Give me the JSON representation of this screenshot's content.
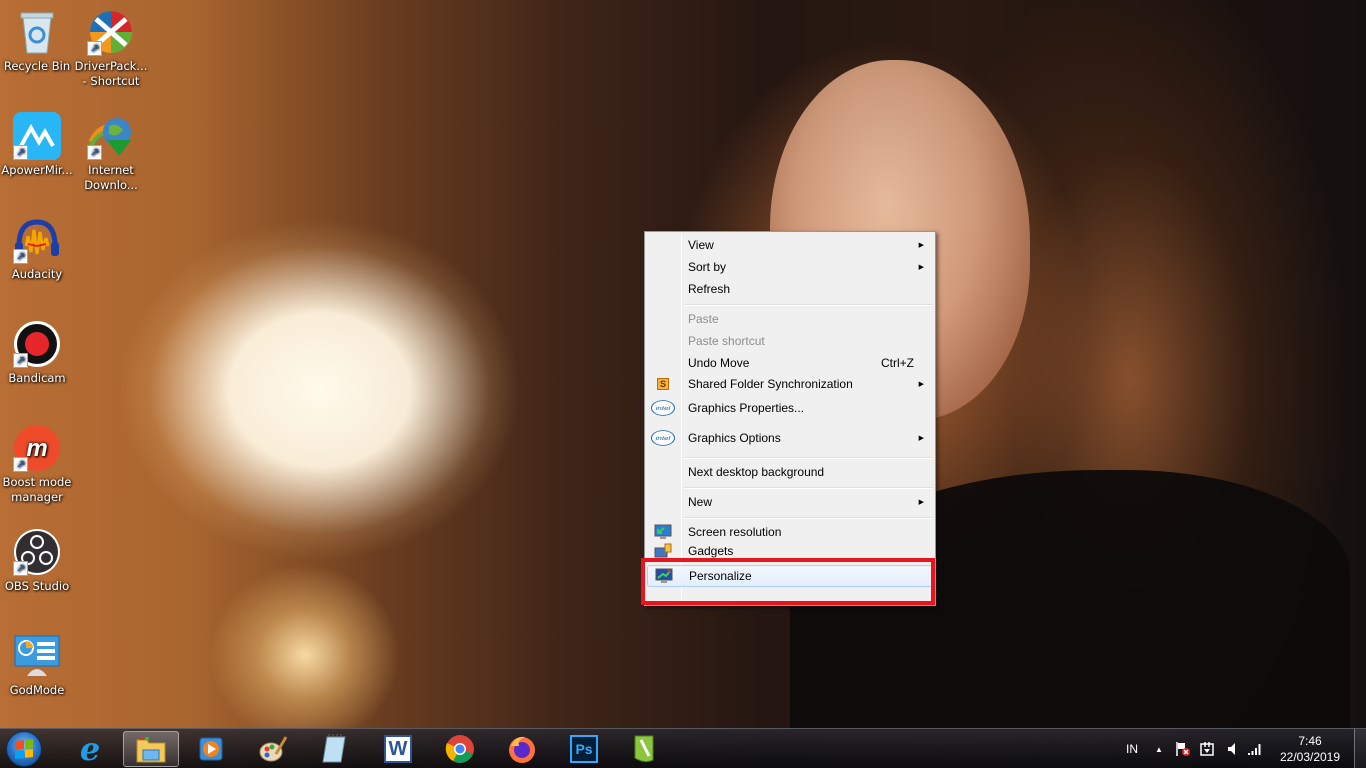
{
  "desktop": {
    "icons": [
      {
        "label": "Recycle Bin",
        "icon": "recycle-bin-icon",
        "shortcut": false
      },
      {
        "label": "DriverPack... - Shortcut",
        "icon": "driverpack-icon",
        "shortcut": true
      },
      {
        "label": "ApowerMir...",
        "icon": "apowermirror-icon",
        "shortcut": true
      },
      {
        "label": "Internet Downlo...",
        "icon": "internet-download-manager-icon",
        "shortcut": true
      },
      {
        "label": "Audacity",
        "icon": "audacity-icon",
        "shortcut": true
      },
      {
        "label": "Bandicam",
        "icon": "bandicam-icon",
        "shortcut": true
      },
      {
        "label": "Boost mode manager",
        "icon": "boost-mode-manager-icon",
        "shortcut": true
      },
      {
        "label": "OBS Studio",
        "icon": "obs-studio-icon",
        "shortcut": true
      },
      {
        "label": "GodMode",
        "icon": "godmode-icon",
        "shortcut": false
      }
    ]
  },
  "context_menu": {
    "items": [
      {
        "label": "View",
        "submenu": true
      },
      {
        "label": "Sort by",
        "submenu": true
      },
      {
        "label": "Refresh"
      },
      {
        "label": "Paste",
        "disabled": true
      },
      {
        "label": "Paste shortcut",
        "disabled": true
      },
      {
        "label": "Undo Move",
        "shortcut": "Ctrl+Z"
      },
      {
        "label": "Shared Folder Synchronization",
        "submenu": true,
        "icon": "shared-folder-sync-icon"
      },
      {
        "label": "Graphics Properties...",
        "icon": "intel-icon"
      },
      {
        "label": "Graphics Options",
        "submenu": true,
        "icon": "intel-icon"
      },
      {
        "label": "Next desktop background"
      },
      {
        "label": "New",
        "submenu": true
      },
      {
        "label": "Screen resolution",
        "icon": "screen-resolution-icon"
      },
      {
        "label": "Gadgets",
        "icon": "gadgets-icon"
      },
      {
        "label": "Personalize",
        "icon": "personalize-icon",
        "highlighted": true
      }
    ],
    "intel_text": "intel",
    "shared_folder_letter": "S",
    "submenu_arrow": "▶"
  },
  "annotation": {
    "color": "#e8141e",
    "target": "Personalize"
  },
  "taskbar": {
    "apps": [
      {
        "name": "Internet Explorer",
        "icon": "internet-explorer-icon"
      },
      {
        "name": "Windows Explorer",
        "icon": "file-explorer-icon",
        "active": true
      },
      {
        "name": "Windows Media Player",
        "icon": "media-player-icon"
      },
      {
        "name": "Paint",
        "icon": "paint-icon"
      },
      {
        "name": "Notepad",
        "icon": "notepad-icon"
      },
      {
        "name": "Microsoft Word",
        "icon": "word-icon",
        "text": "W"
      },
      {
        "name": "Google Chrome",
        "icon": "chrome-icon"
      },
      {
        "name": "Firefox",
        "icon": "firefox-icon"
      },
      {
        "name": "Photoshop",
        "icon": "photoshop-icon",
        "text": "Ps"
      },
      {
        "name": "CorelDRAW",
        "icon": "coreldraw-icon"
      }
    ],
    "tray": {
      "language": "IN",
      "show_hidden_arrow": "▲",
      "time": "7:46",
      "date": "22/03/2019"
    }
  }
}
